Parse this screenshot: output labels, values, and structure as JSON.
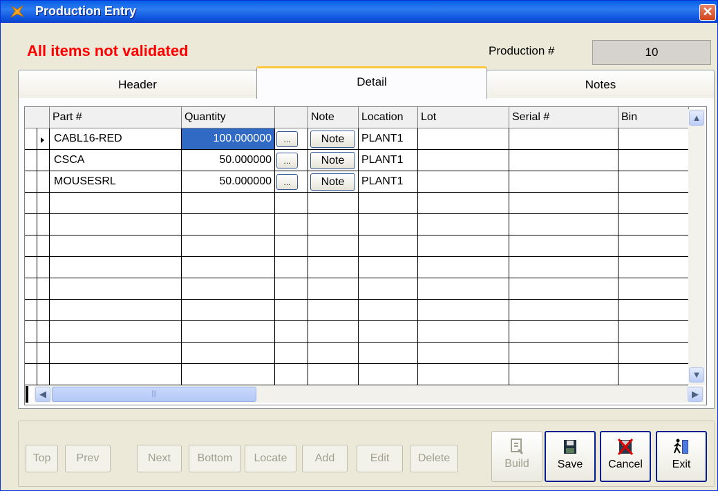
{
  "window": {
    "title": "Production Entry",
    "close_label": "✕"
  },
  "status": {
    "warning": "All items not validated"
  },
  "production": {
    "label": "Production #",
    "value": "10"
  },
  "tabs": [
    {
      "label": "Header"
    },
    {
      "label": "Detail"
    },
    {
      "label": "Notes"
    }
  ],
  "grid": {
    "columns": [
      "Part #",
      "Quantity",
      "",
      "Note",
      "Location",
      "Lot",
      "Serial #",
      "Bin"
    ],
    "rows": [
      {
        "part": "CABL16-RED",
        "quantity": "100.000000",
        "ellipsis": "...",
        "note": "Note",
        "location": "PLANT1",
        "lot": "",
        "serial": "",
        "bin": ""
      },
      {
        "part": "CSCA",
        "quantity": "50.000000",
        "ellipsis": "...",
        "note": "Note",
        "location": "PLANT1",
        "lot": "",
        "serial": "",
        "bin": ""
      },
      {
        "part": "MOUSESRL",
        "quantity": "50.000000",
        "ellipsis": "...",
        "note": "Note",
        "location": "PLANT1",
        "lot": "",
        "serial": "",
        "bin": ""
      }
    ],
    "scroll_up": "▲",
    "scroll_down": "▼",
    "scroll_left": "◀",
    "scroll_right": "▶",
    "thumb_grip": "|||"
  },
  "nav_buttons": [
    "Top",
    "Prev",
    "Next",
    "Bottom",
    "Locate",
    "Add",
    "Edit",
    "Delete"
  ],
  "action_buttons": [
    {
      "label": "Build",
      "icon": "build-icon",
      "enabled": false
    },
    {
      "label": "Save",
      "icon": "save-icon",
      "enabled": true
    },
    {
      "label": "Cancel",
      "icon": "cancel-icon",
      "enabled": true
    },
    {
      "label": "Exit",
      "icon": "exit-icon",
      "enabled": true
    }
  ],
  "colors": {
    "warning": "#ff0000",
    "selection": "#316ac5",
    "active_tab_accent": "#ffc83c"
  }
}
